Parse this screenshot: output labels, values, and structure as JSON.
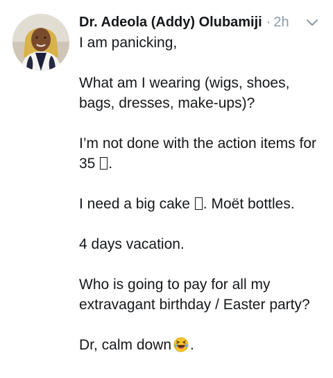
{
  "author": {
    "display_name": "Dr. Adeola (Addy) Olubamiji",
    "separator": "·",
    "time": "2h"
  },
  "tweet": {
    "line1": "I am panicking,",
    "line2": "What am I wearing (wigs, shoes, bags, dresses, make-ups)?",
    "line3a": "I’m not done with the action items for 35",
    "line3b": ".",
    "line4a": "I need a big cake",
    "line4b": ". Moët bottles.",
    "line5": "4 days vacation.",
    "line6": "Who is going to pay for all my extravagant birthday / Easter party?",
    "line7a": "Dr, calm down",
    "line7b": "."
  },
  "icons": {
    "avatar": "profile-photo",
    "caret": "chevron-down-icon",
    "missing_glyph": "missing-glyph-box",
    "laugh_emoji": "rolling-on-floor-laughing-emoji"
  },
  "colors": {
    "text": "#14171a",
    "muted": "#8899a6",
    "emoji_yellow": "#f7c42b"
  }
}
